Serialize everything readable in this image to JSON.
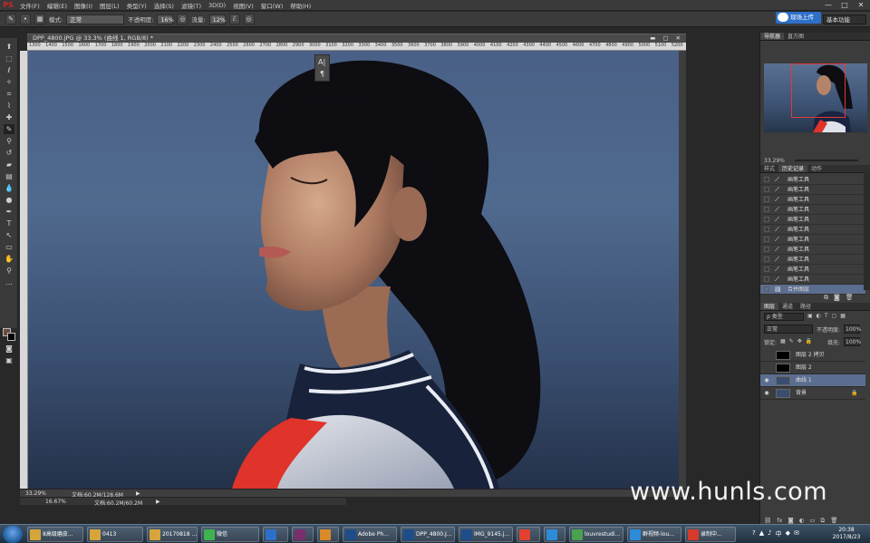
{
  "app": {
    "logo": "PS",
    "menu": [
      "文件(F)",
      "编辑(E)",
      "图像(I)",
      "图层(L)",
      "类型(Y)",
      "选择(S)",
      "滤镜(T)",
      "3D(D)",
      "视图(V)",
      "窗口(W)",
      "帮助(H)"
    ],
    "window_controls": [
      "—",
      "□",
      "✕"
    ],
    "brand_red": "#c62828"
  },
  "options_bar": {
    "brush_size": "",
    "mode_label": "模式:",
    "mode_value": "正常",
    "opacity_label": "不透明度:",
    "opacity_value": "16%",
    "flow_label": "流量:",
    "flow_value": "12%",
    "cloud_button": "现场上传",
    "workspace": "基本功能"
  },
  "document": {
    "tab_title": "DPP_4800.JPG @ 33.3% (曲线 1, RGB/8) *",
    "ruler_ticks": [
      "1300",
      "1400",
      "1500",
      "1600",
      "1700",
      "1800",
      "1900",
      "2000",
      "2100",
      "2200",
      "2300",
      "2400",
      "2500",
      "2600",
      "2700",
      "2800",
      "2900",
      "3000",
      "3100",
      "3200",
      "3300",
      "3400",
      "3500",
      "3600",
      "3700",
      "3800",
      "3900",
      "4000",
      "4100",
      "4200",
      "4300",
      "4400",
      "4500",
      "4600",
      "4700",
      "4800",
      "4900",
      "5000",
      "5100",
      "5200"
    ],
    "status_zoom": "33.29%",
    "status_doc": "文档:60.2M/128.6M",
    "second_zoom": "16.67%",
    "second_doc": "文档:60.2M/60.2M"
  },
  "navigator": {
    "tabs": [
      "导航器",
      "直方图"
    ],
    "zoom": "33.29%"
  },
  "history": {
    "tabs": [
      "样式",
      "历史记录",
      "动作"
    ],
    "items": [
      "画笔工具",
      "画笔工具",
      "画笔工具",
      "画笔工具",
      "画笔工具",
      "画笔工具",
      "画笔工具",
      "画笔工具",
      "画笔工具",
      "画笔工具",
      "画笔工具",
      "合并图层"
    ]
  },
  "layers": {
    "tabs": [
      "图层",
      "通道",
      "路径"
    ],
    "filter_label": "ρ 类型",
    "blend_mode": "正常",
    "opacity_label": "不透明度:",
    "opacity_value": "100%",
    "lock_label": "锁定:",
    "fill_label": "填充:",
    "fill_value": "100%",
    "items": [
      {
        "name": "图层 2 拷贝",
        "visible": false,
        "thumb": "#000000"
      },
      {
        "name": "图层 2",
        "visible": false,
        "thumb": "#000000"
      },
      {
        "name": "曲线 1",
        "visible": true,
        "thumb": "#3a4d6e"
      },
      {
        "name": "背景",
        "visible": true,
        "thumb": "#3a4d6e"
      }
    ]
  },
  "watermark": "www.hunls.com",
  "taskbar": {
    "items": [
      {
        "label": "8高级磨皮...",
        "color": "#d6a53a"
      },
      {
        "label": "0413",
        "color": "#d6a53a"
      },
      {
        "label": "20170818 ...",
        "color": "#d6a53a"
      },
      {
        "label": "微信",
        "color": "#3fb34f"
      },
      {
        "label": "",
        "color": "#2d6fc9"
      },
      {
        "label": "",
        "color": "#7a2f6d"
      },
      {
        "label": "",
        "color": "#d98a2a"
      },
      {
        "label": "Adobe Ph...",
        "color": "#1f4d8a"
      },
      {
        "label": "DPP_4800.J...",
        "color": "#1f4d8a"
      },
      {
        "label": "IMG_9145.j...",
        "color": "#1f4d8a"
      },
      {
        "label": "",
        "color": "#e2412f"
      },
      {
        "label": "",
        "color": "#2e8bd8"
      },
      {
        "label": "louvrestudi...",
        "color": "#4aa14f"
      },
      {
        "label": "群视频-lou...",
        "color": "#2e8bd8"
      },
      {
        "label": "录制中...",
        "color": "#d63a2a"
      }
    ],
    "time": "20:38",
    "date": "2017/8/23"
  }
}
